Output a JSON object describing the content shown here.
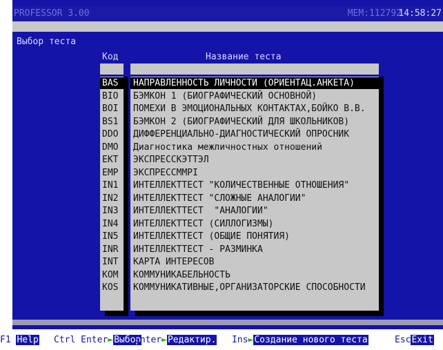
{
  "header": {
    "app_title": "PROFESSOR 3.00",
    "memory": "MEM:112792",
    "clock": "14:58:27"
  },
  "panel": {
    "title": "Выбор теста",
    "col_code": "Код",
    "col_name": "Название теста"
  },
  "tests": [
    {
      "code": "BAS",
      "name": "НАПРАВЛЕННОСТЬ ЛИЧНОСТИ (ОРИЕНТАЦ.АНКЕТА)",
      "selected": true
    },
    {
      "code": "BIO",
      "name": "БЭМКОН 1 (БИОГРАФИЧЕСКИЙ ОСНОВНОЙ)"
    },
    {
      "code": "BOI",
      "name": "ПОМЕХИ В ЭМОЦИОНАЛЬНЫХ КОНТАКТАХ,БОЙКО В.В."
    },
    {
      "code": "BS1",
      "name": "БЭМКОН 2 (БИОГРАФИЧЕСКИЙ ДЛЯ ШКОЛЬНИКОВ)"
    },
    {
      "code": "DDO",
      "name": "ДИФФЕРЕНЦИАЛЬНО-ДИАГНОСТИЧЕСКИЙ ОПРОСНИК"
    },
    {
      "code": "DMO",
      "name": "Диагностика межличностных отношений"
    },
    {
      "code": "EKT",
      "name": "ЭКСПРЕССКЭТТЭЛ"
    },
    {
      "code": "EMP",
      "name": "ЭКСПРЕССММPI"
    },
    {
      "code": "IN1",
      "name": "ИНТЕЛЛЕКТТЕСТ \"КОЛИЧЕСТВЕННЫЕ ОТНОШЕНИЯ\""
    },
    {
      "code": "IN2",
      "name": "ИНТЕЛЛЕКТТЕСТ \"СЛОЖНЫЕ АНАЛОГИИ\""
    },
    {
      "code": "IN3",
      "name": "ИНТЕЛЛЕКТТЕСТ  \"АНАЛОГИИ\""
    },
    {
      "code": "IN4",
      "name": "ИНТЕЛЛЕКТТЕСТ (СИЛЛОГИЗМЫ)"
    },
    {
      "code": "IN5",
      "name": "ИНТЕЛЛЕКТТЕСТ (ОБЩИЕ ПОНЯТИЯ)"
    },
    {
      "code": "INR",
      "name": "ИНТЕЛЛЕКТТЕСТ - РАЗМИНКА"
    },
    {
      "code": "INT",
      "name": "КАРТА ИНТЕРЕСОВ"
    },
    {
      "code": "KOM",
      "name": "КОММУНИКАБЕЛЬНОСТЬ"
    },
    {
      "code": "KOS",
      "name": "КОММУНИКАТИВНЫЕ,ОРГАНИЗАТОРСКИЕ СПОСОБНОСТИ"
    }
  ],
  "statusbar": {
    "f1_key": "F1",
    "f1_label": "Help",
    "ctrl_key": "Ctrl Enter",
    "ctrl_label": "Выбор",
    "enter_key": "Enter",
    "enter_label": "Редактир.",
    "ins_key": "Ins",
    "ins_label": "Создание нового теста",
    "esc_key": "Esc",
    "esc_label": "Exit"
  },
  "colors": {
    "background": "#1414a8",
    "list": "#c8c8c8",
    "selection": "#000000",
    "arrow": "#20b020"
  }
}
